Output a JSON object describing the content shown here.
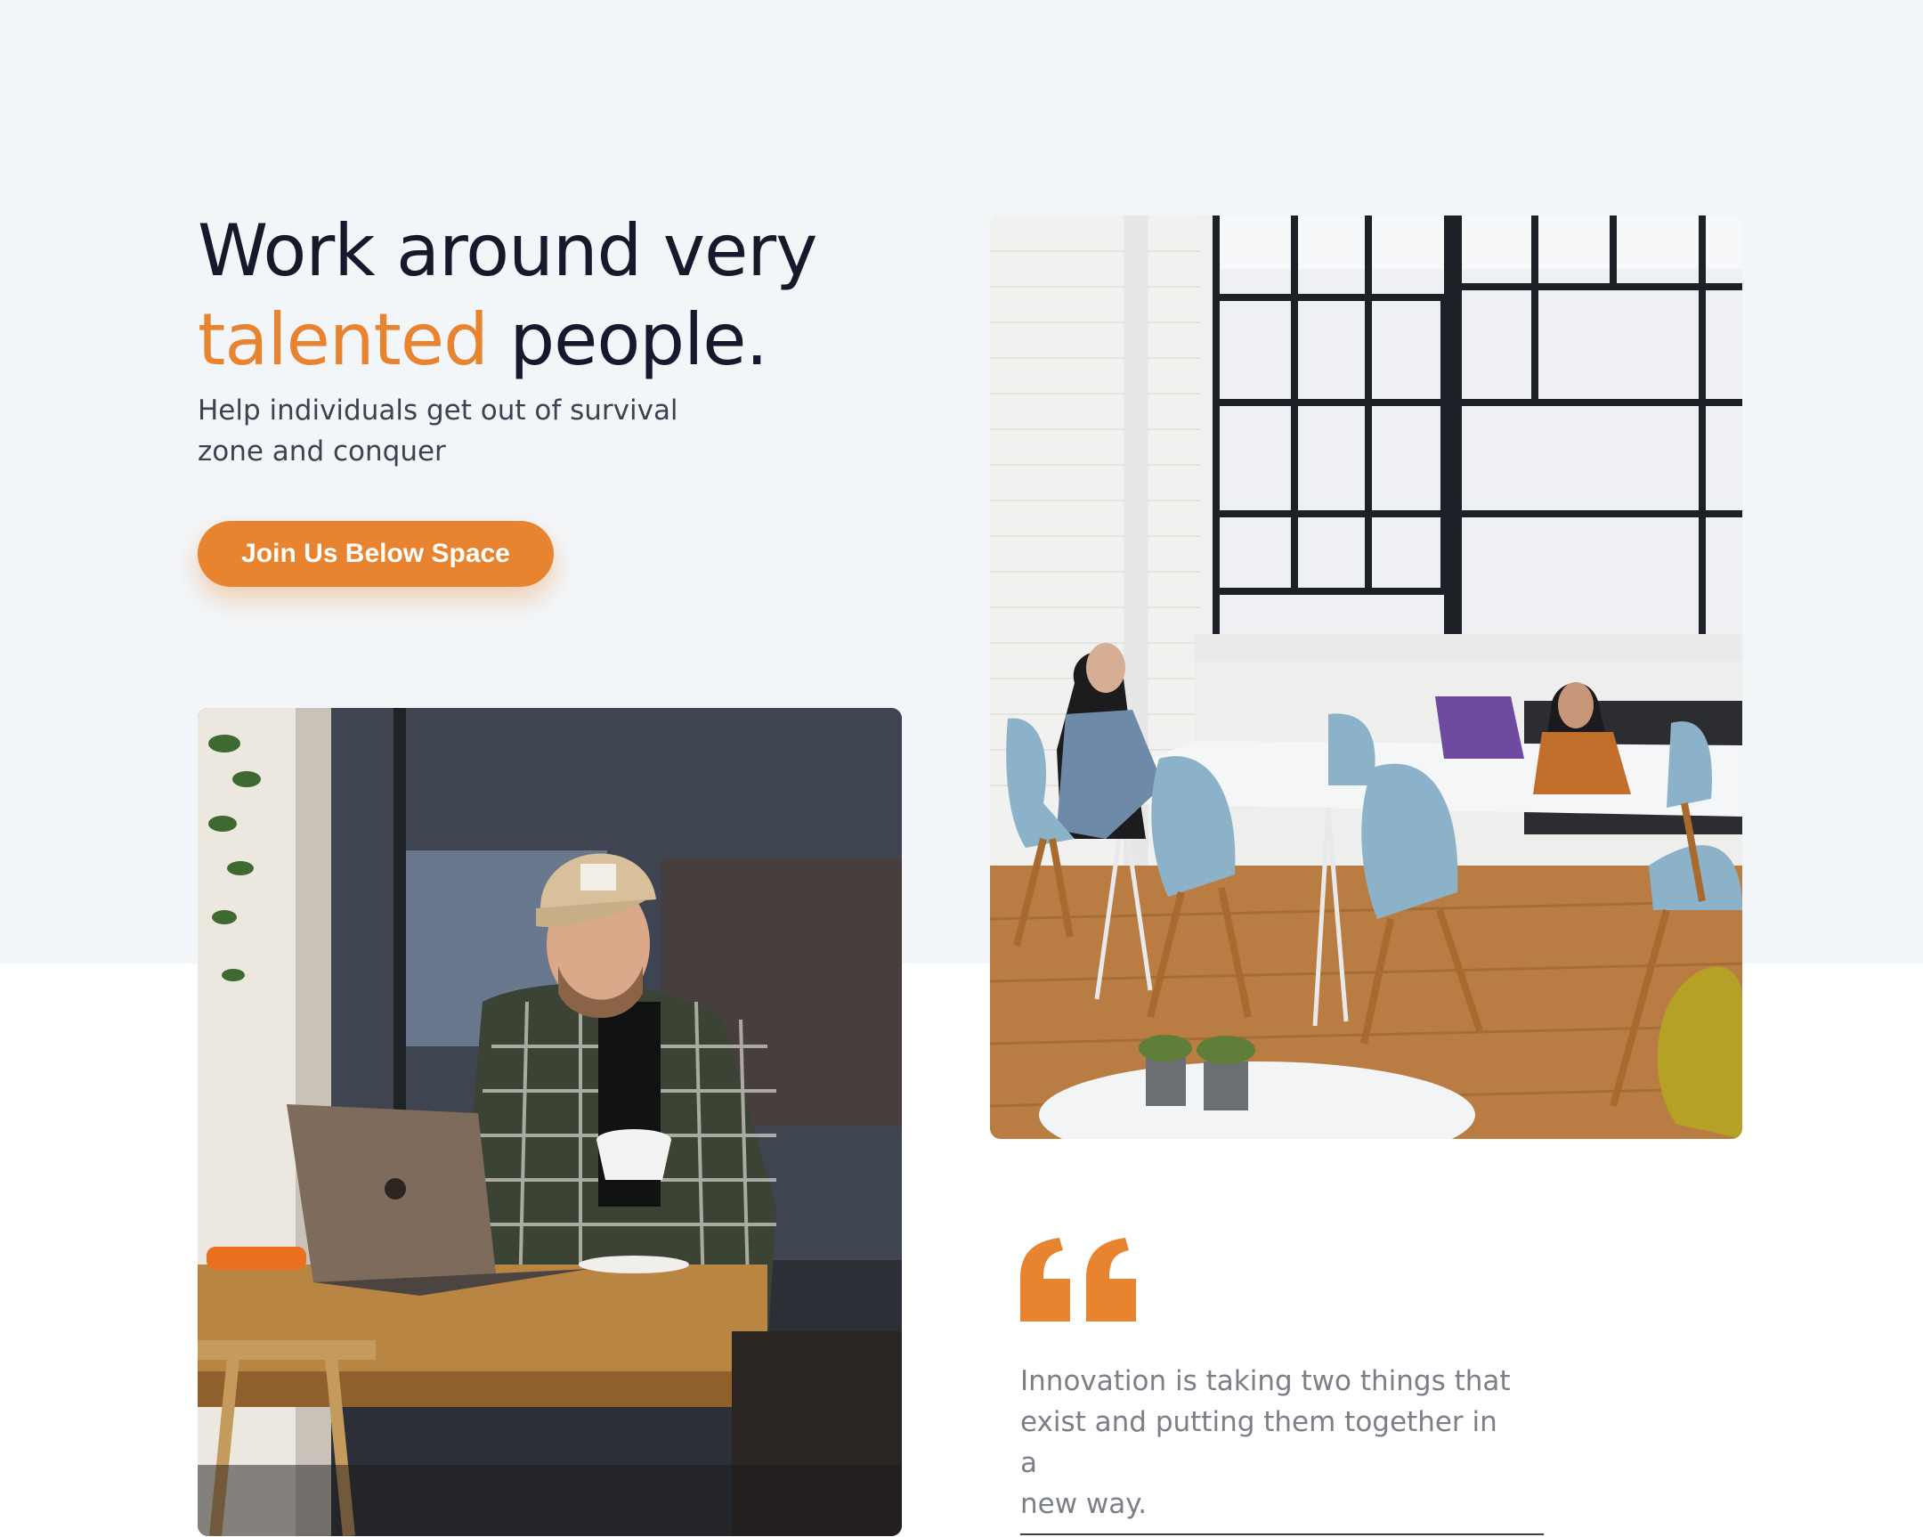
{
  "hero": {
    "headline_line1": "Work around very",
    "headline_accent": "talented",
    "headline_rest": "people.",
    "subtitle_line1": "Help individuals get out of survival",
    "subtitle_line2": "zone and conquer",
    "cta_label": "Join Us Below Space"
  },
  "images": {
    "meeting_room": "photo of two women working at laptops at a white table with blue chairs",
    "cafe": "photo of a man in a cap and plaid shirt drinking coffee at a laptop"
  },
  "quote": {
    "icon": "quote-icon",
    "line1": "Innovation is taking two things that",
    "line2": "exist and putting them together in a",
    "line3": "new way."
  },
  "colors": {
    "accent": "#e8832f",
    "heading": "#141a2c",
    "top_band": "#f3f6f9",
    "quote_text": "#7b7f88"
  }
}
